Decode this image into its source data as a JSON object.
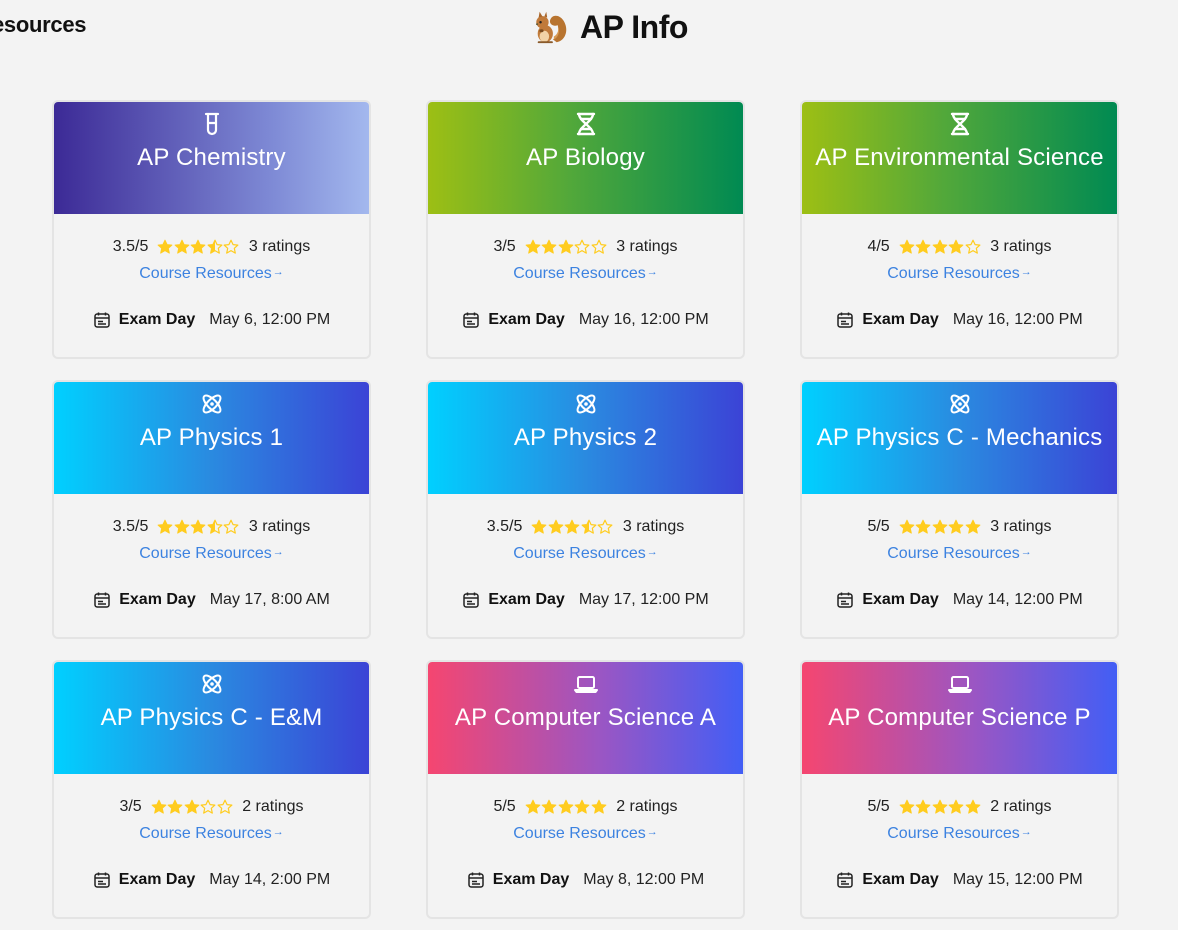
{
  "header": {
    "left_title": "esources",
    "app_title": "AP Info",
    "logo_icon": "squirrel-icon"
  },
  "colors": {
    "star": "#ffcc1f",
    "link": "#3c82e0",
    "chemistry_gradient": [
      "#3c2a96",
      "#a3b8ee"
    ],
    "biology_gradient": [
      "#9dbf14",
      "#008a52"
    ],
    "physics_gradient": [
      "#00d0ff",
      "#3b43d6"
    ],
    "cs_gradient": [
      "#f54670",
      "#425ef5"
    ]
  },
  "courses": [
    {
      "title": "AP Chemistry",
      "icon": "test-tube-icon",
      "gradient": "chem",
      "rating_text": "3.5/5",
      "rating": 3.5,
      "ratings_count": "3 ratings",
      "resources_label": "Course Resources",
      "exam_label": "Exam Day",
      "exam_date": "May 6, 12:00 PM"
    },
    {
      "title": "AP Biology",
      "icon": "dna-icon",
      "gradient": "bio",
      "rating_text": "3/5",
      "rating": 3,
      "ratings_count": "3 ratings",
      "resources_label": "Course Resources",
      "exam_label": "Exam Day",
      "exam_date": "May 16, 12:00 PM"
    },
    {
      "title": "AP Environmental Science",
      "icon": "dna-icon",
      "gradient": "bio",
      "rating_text": "4/5",
      "rating": 4,
      "ratings_count": "3 ratings",
      "resources_label": "Course Resources",
      "exam_label": "Exam Day",
      "exam_date": "May 16, 12:00 PM"
    },
    {
      "title": "AP Physics 1",
      "icon": "atom-icon",
      "gradient": "phys",
      "rating_text": "3.5/5",
      "rating": 3.5,
      "ratings_count": "3 ratings",
      "resources_label": "Course Resources",
      "exam_label": "Exam Day",
      "exam_date": "May 17, 8:00 AM"
    },
    {
      "title": "AP Physics 2",
      "icon": "atom-icon",
      "gradient": "phys",
      "rating_text": "3.5/5",
      "rating": 3.5,
      "ratings_count": "3 ratings",
      "resources_label": "Course Resources",
      "exam_label": "Exam Day",
      "exam_date": "May 17, 12:00 PM"
    },
    {
      "title": "AP Physics C - Mechanics",
      "icon": "atom-icon",
      "gradient": "phys",
      "rating_text": "5/5",
      "rating": 5,
      "ratings_count": "3 ratings",
      "resources_label": "Course Resources",
      "exam_label": "Exam Day",
      "exam_date": "May 14, 12:00 PM"
    },
    {
      "title": "AP Physics C - E&M",
      "icon": "atom-icon",
      "gradient": "phys",
      "rating_text": "3/5",
      "rating": 3,
      "ratings_count": "2 ratings",
      "resources_label": "Course Resources",
      "exam_label": "Exam Day",
      "exam_date": "May 14, 2:00 PM"
    },
    {
      "title": "AP Computer Science A",
      "icon": "laptop-icon",
      "gradient": "cs",
      "rating_text": "5/5",
      "rating": 5,
      "ratings_count": "2 ratings",
      "resources_label": "Course Resources",
      "exam_label": "Exam Day",
      "exam_date": "May 8, 12:00 PM"
    },
    {
      "title": "AP Computer Science P",
      "icon": "laptop-icon",
      "gradient": "cs",
      "rating_text": "5/5",
      "rating": 5,
      "ratings_count": "2 ratings",
      "resources_label": "Course Resources",
      "exam_label": "Exam Day",
      "exam_date": "May 15, 12:00 PM"
    }
  ]
}
